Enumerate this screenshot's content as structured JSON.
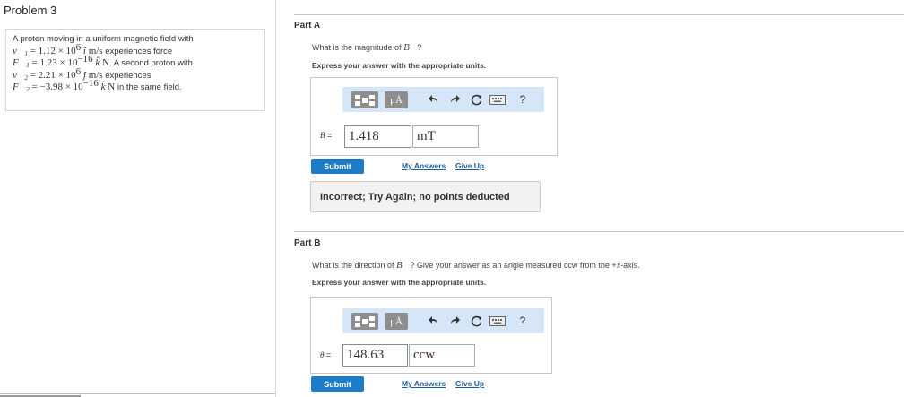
{
  "problem": {
    "title": "Problem 3",
    "statement_lines": [
      {
        "pre": "A proton moving in a uniform magnetic field with"
      },
      {
        "var": "v",
        "sub": "1",
        "eq": " = 1.12 × 10",
        "exp": "6",
        "unitvec": " î",
        "unit": " m/s",
        "tail": " experiences force"
      },
      {
        "var": "F",
        "sub": "1",
        "eq": " = 1.23 × 10",
        "exp": "−16",
        "unitvec": " k̂",
        "unit": " N",
        "tail": ". A second proton with"
      },
      {
        "var": "v",
        "sub": "2",
        "eq": " = 2.21 × 10",
        "exp": "6",
        "unitvec": " ĵ",
        "unit": " m/s",
        "tail": " experiences"
      },
      {
        "var": "F",
        "sub": "2",
        "eq": " = −3.98 × 10",
        "exp": "−16",
        "unitvec": " k̂",
        "unit": " N",
        "tail": " in the same field."
      }
    ]
  },
  "part_a": {
    "label": "Part A",
    "question_pre": "What is the magnitude of ",
    "question_var": "B⃗",
    "question_post": "?",
    "instruction": "Express your answer with the appropriate units.",
    "var_label": "B",
    "equals": " =",
    "value": "1.418",
    "unit": "mT",
    "submit": "Submit",
    "my_answers": "My Answers",
    "give_up": "Give Up",
    "feedback": "Incorrect; Try Again; no points deducted"
  },
  "part_b": {
    "label": "Part B",
    "question_pre": "What is the direction of ",
    "question_var": "B⃗",
    "question_post": "? Give your answer as an angle measured ccw from the +",
    "question_axis": "x",
    "question_end": "-axis.",
    "instruction": "Express your answer with the appropriate units.",
    "var_label": "θ",
    "equals": " =",
    "value": "148.63",
    "unit": "ccw",
    "submit": "Submit",
    "my_answers": "My Answers",
    "give_up": "Give Up"
  },
  "toolbar": {
    "mu_label": "μÅ",
    "help": "?",
    "icons": [
      "matrix-template-icon",
      "units-icon",
      "undo-icon",
      "redo-icon",
      "reset-icon",
      "keyboard-icon",
      "help-icon"
    ]
  },
  "colors": {
    "toolbar_bg": "#d4e6f8",
    "submit_bg": "#1d7cc8",
    "link": "#1f5e9a"
  }
}
